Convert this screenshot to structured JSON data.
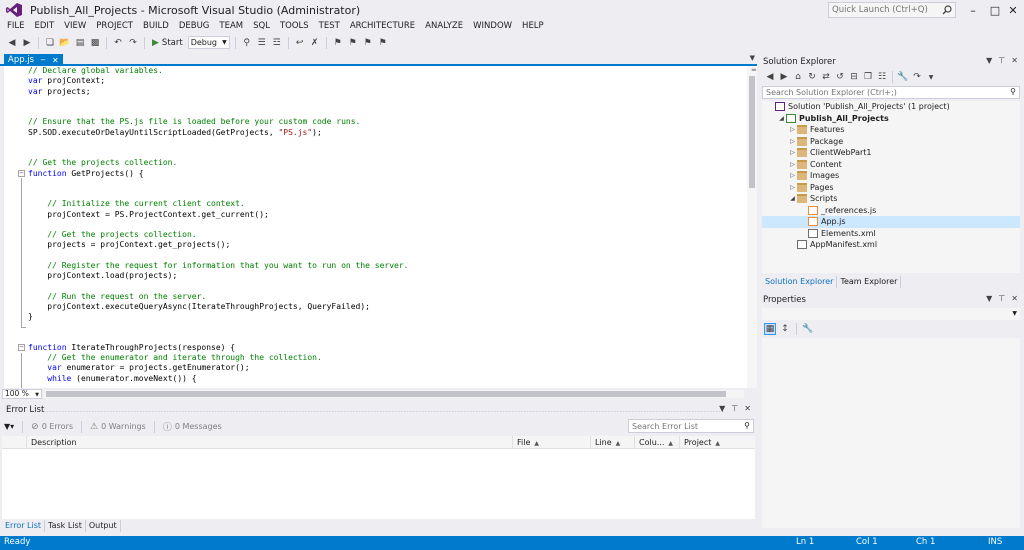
{
  "window": {
    "title": "Publish_All_Projects - Microsoft Visual Studio (Administrator)",
    "quick_launch_placeholder": "Quick Launch (Ctrl+Q)"
  },
  "menu": [
    "FILE",
    "EDIT",
    "VIEW",
    "PROJECT",
    "BUILD",
    "DEBUG",
    "TEAM",
    "SQL",
    "TOOLS",
    "TEST",
    "ARCHITECTURE",
    "ANALYZE",
    "WINDOW",
    "HELP"
  ],
  "toolbar": {
    "start_label": "Start",
    "configuration": "Debug"
  },
  "editor": {
    "tab_label": "App.js",
    "zoom": "100 %",
    "lines": [
      {
        "t": "comment",
        "text": "// Declare global variables."
      },
      {
        "t": "mixed",
        "parts": [
          [
            "kw",
            "var"
          ],
          [
            "plain",
            " projContext;"
          ]
        ]
      },
      {
        "t": "mixed",
        "parts": [
          [
            "kw",
            "var"
          ],
          [
            "plain",
            " projects;"
          ]
        ]
      },
      {
        "t": "blank"
      },
      {
        "t": "blank"
      },
      {
        "t": "comment",
        "text": "// Ensure that the PS.js file is loaded before your custom code runs."
      },
      {
        "t": "mixed",
        "parts": [
          [
            "plain",
            "SP.SOD.executeOrDelayUntilScriptLoaded(GetProjects, "
          ],
          [
            "str",
            "\"PS.js\""
          ],
          [
            "plain",
            ");"
          ]
        ]
      },
      {
        "t": "blank"
      },
      {
        "t": "blank"
      },
      {
        "t": "comment",
        "text": "// Get the projects collection."
      },
      {
        "t": "mixed",
        "fold": true,
        "parts": [
          [
            "kw",
            "function"
          ],
          [
            "plain",
            " GetProjects() {"
          ]
        ]
      },
      {
        "t": "blank"
      },
      {
        "t": "blank"
      },
      {
        "t": "comment",
        "text": "    // Initialize the current client context."
      },
      {
        "t": "plain",
        "text": "    projContext = PS.ProjectContext.get_current();"
      },
      {
        "t": "blank"
      },
      {
        "t": "comment",
        "text": "    // Get the projects collection."
      },
      {
        "t": "plain",
        "text": "    projects = projContext.get_projects();"
      },
      {
        "t": "blank"
      },
      {
        "t": "comment",
        "text": "    // Register the request for information that you want to run on the server."
      },
      {
        "t": "plain",
        "text": "    projContext.load(projects);"
      },
      {
        "t": "blank"
      },
      {
        "t": "comment",
        "text": "    // Run the request on the server."
      },
      {
        "t": "plain",
        "text": "    projContext.executeQueryAsync(IterateThroughProjects, QueryFailed);"
      },
      {
        "t": "plain",
        "text": "}"
      },
      {
        "t": "blank"
      },
      {
        "t": "blank"
      },
      {
        "t": "mixed",
        "fold": true,
        "parts": [
          [
            "kw",
            "function"
          ],
          [
            "plain",
            " IterateThroughProjects(response) {"
          ]
        ]
      },
      {
        "t": "comment",
        "text": "    // Get the enumerator and iterate through the collection."
      },
      {
        "t": "mixed",
        "parts": [
          [
            "plain",
            "    "
          ],
          [
            "kw",
            "var"
          ],
          [
            "plain",
            " enumerator = projects.getEnumerator();"
          ]
        ]
      },
      {
        "t": "mixed",
        "parts": [
          [
            "plain",
            "    "
          ],
          [
            "kw",
            "while"
          ],
          [
            "plain",
            " (enumerator.moveNext()) {"
          ]
        ]
      }
    ]
  },
  "error_list": {
    "title": "Error List",
    "errors": "0 Errors",
    "warnings": "0 Warnings",
    "messages": "0 Messages",
    "search_placeholder": "Search Error List",
    "columns": [
      "Description",
      "File",
      "Line",
      "Colu...",
      "Project"
    ],
    "bottom_tabs": [
      "Error List",
      "Task List",
      "Output"
    ]
  },
  "solution_explorer": {
    "title": "Solution Explorer",
    "search_placeholder": "Search Solution Explorer (Ctrl+;)",
    "tree": [
      {
        "label": "Solution 'Publish_All_Projects' (1 project)",
        "indent": 0,
        "arrow": "",
        "icon": "solution"
      },
      {
        "label": "Publish_All_Projects",
        "indent": 1,
        "arrow": "◢",
        "icon": "project",
        "bold": true
      },
      {
        "label": "Features",
        "indent": 2,
        "arrow": "▷",
        "icon": "folder"
      },
      {
        "label": "Package",
        "indent": 2,
        "arrow": "▷",
        "icon": "folder"
      },
      {
        "label": "ClientWebPart1",
        "indent": 2,
        "arrow": "▷",
        "icon": "folder"
      },
      {
        "label": "Content",
        "indent": 2,
        "arrow": "▷",
        "icon": "folder"
      },
      {
        "label": "Images",
        "indent": 2,
        "arrow": "▷",
        "icon": "folder"
      },
      {
        "label": "Pages",
        "indent": 2,
        "arrow": "▷",
        "icon": "folder"
      },
      {
        "label": "Scripts",
        "indent": 2,
        "arrow": "◢",
        "icon": "folder"
      },
      {
        "label": "_references.js",
        "indent": 3,
        "arrow": "",
        "icon": "js"
      },
      {
        "label": "App.js",
        "indent": 3,
        "arrow": "",
        "icon": "js",
        "selected": true
      },
      {
        "label": "Elements.xml",
        "indent": 3,
        "arrow": "",
        "icon": "xml"
      },
      {
        "label": "AppManifest.xml",
        "indent": 2,
        "arrow": "",
        "icon": "xml"
      }
    ],
    "tabs": [
      "Solution Explorer",
      "Team Explorer"
    ]
  },
  "properties": {
    "title": "Properties"
  },
  "status": {
    "left": "Ready",
    "line": "Ln 1",
    "col": "Col 1",
    "ch": "Ch 1",
    "mode": "INS"
  },
  "colors": {
    "accent": "#007acc",
    "comment": "#008000",
    "keyword": "#0000ff",
    "string": "#a31515"
  }
}
